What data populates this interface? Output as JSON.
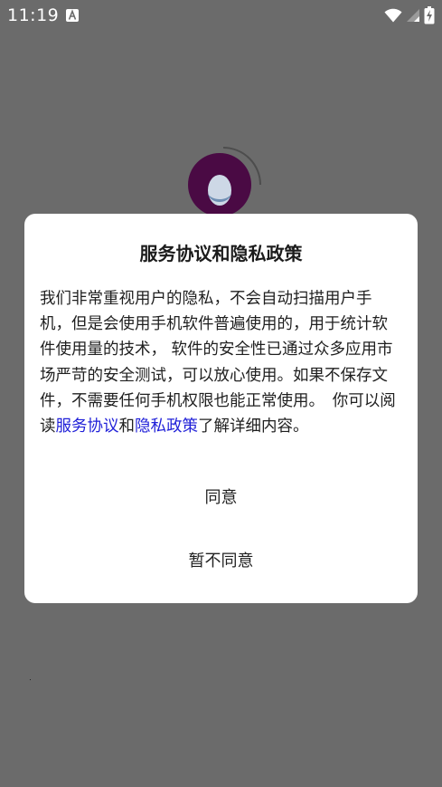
{
  "status_bar": {
    "time": "11:19",
    "notification_icon": "a-letter-icon",
    "wifi_icon": "wifi-icon",
    "signal_icon": "signal-icon",
    "battery_icon": "battery-charging-icon"
  },
  "background": {
    "app_logo_icon": "app-logo-icon"
  },
  "dialog": {
    "title": "服务协议和隐私政策",
    "body_text": "我们非常重视用户的隐私，不会自动扫描用户手机，但是会使用手机软件普遍使用的，用于统计软件使用量的技术， 软件的安全性已通过众多应用市场严苛的安全测试，可以放心使用。如果不保存文件，不需要任何手机权限也能正常使用。　你可以阅读",
    "link_service": "服务协议",
    "and_text": "和",
    "link_privacy": "隐私政策",
    "tail_text": "了解详细内容。",
    "agree_label": "同意",
    "disagree_label": "暂不同意"
  },
  "colors": {
    "overlay": "#6b6b6b",
    "link": "#2020d8",
    "dialog_bg": "#ffffff"
  }
}
